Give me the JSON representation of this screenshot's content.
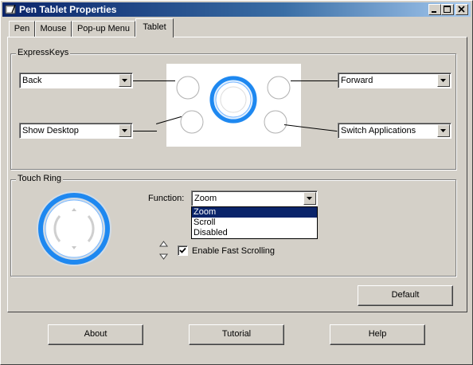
{
  "window": {
    "title": "Pen Tablet Properties"
  },
  "tabs": [
    {
      "label": "Pen"
    },
    {
      "label": "Mouse"
    },
    {
      "label": "Pop-up Menu"
    },
    {
      "label": "Tablet"
    }
  ],
  "active_tab": "Tablet",
  "expresskeys": {
    "group_label": "ExpressKeys",
    "top_left": "Back",
    "bottom_left": "Show Desktop",
    "top_right": "Forward",
    "bottom_right": "Switch Applications"
  },
  "touch_ring": {
    "group_label": "Touch Ring",
    "function_label": "Function:",
    "function_value": "Zoom",
    "options": [
      "Zoom",
      "Scroll",
      "Disabled"
    ],
    "selected_option": "Zoom",
    "fast_scrolling_label": "Enable Fast Scrolling",
    "fast_scrolling_checked": true
  },
  "buttons": {
    "default": "Default",
    "about": "About",
    "tutorial": "Tutorial",
    "help": "Help"
  },
  "colors": {
    "titlebar": "#0a246a",
    "ring_blue": "#1e88f0",
    "selection": "#0a246a"
  },
  "icons": [
    "tablet-icon",
    "minimize-icon",
    "maximize-icon",
    "close-icon",
    "chevron-down-icon",
    "scroll-up-icon",
    "scroll-down-icon",
    "checkmark-icon"
  ]
}
